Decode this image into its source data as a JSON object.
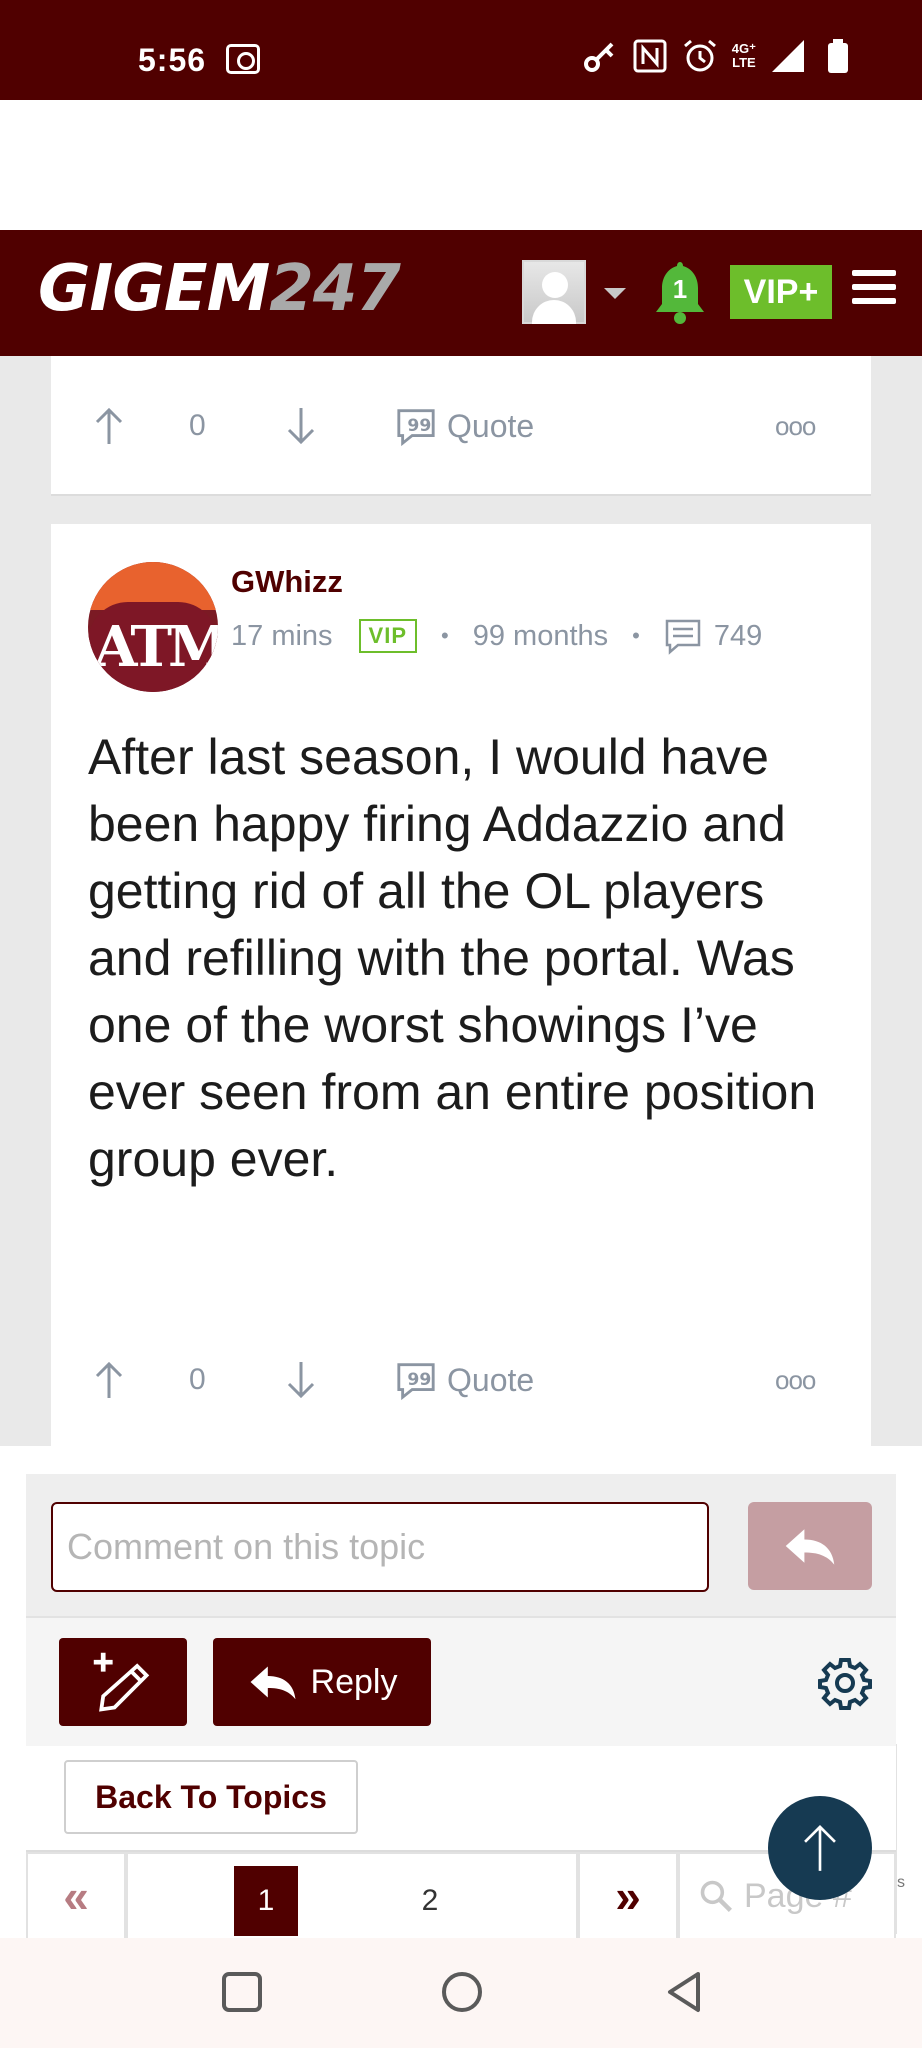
{
  "status_bar": {
    "time": "5:56",
    "network_top": "4G⁺",
    "network_bottom": "LTE",
    "icons": [
      "screen-record-icon",
      "vpn-key-icon",
      "nfc-icon",
      "alarm-icon",
      "signal-icon",
      "battery-icon"
    ]
  },
  "header": {
    "logo_main": "GIGEM",
    "logo_num": "247",
    "notification_count": "1",
    "vip_label": "VIP+",
    "brand_color": "#500000",
    "vip_color": "#6dbe2b"
  },
  "prev_post": {
    "vote_count": "0",
    "quote_label": "Quote",
    "more_label": "ooo"
  },
  "post": {
    "username": "GWhizz",
    "time_ago": "17 mins",
    "badge": "VIP",
    "tenure": "99 months",
    "post_count": "749",
    "avatar_text": "ATM",
    "body": "After last season, I would have been happy firing Addazzio and getting rid of all the OL players and refilling with the portal. Was one of the worst showings I’ve ever seen from an entire position group ever.",
    "vote_count": "0",
    "quote_label": "Quote",
    "more_label": "ooo"
  },
  "comment": {
    "placeholder": "Comment on this topic"
  },
  "toolbar": {
    "reply_label": "Reply",
    "back_label": "Back To Topics"
  },
  "pagination": {
    "first": "«",
    "last": "»",
    "pages": [
      "1",
      "2"
    ],
    "current": "1",
    "search_placeholder": "Page #"
  },
  "edge_text": "s"
}
